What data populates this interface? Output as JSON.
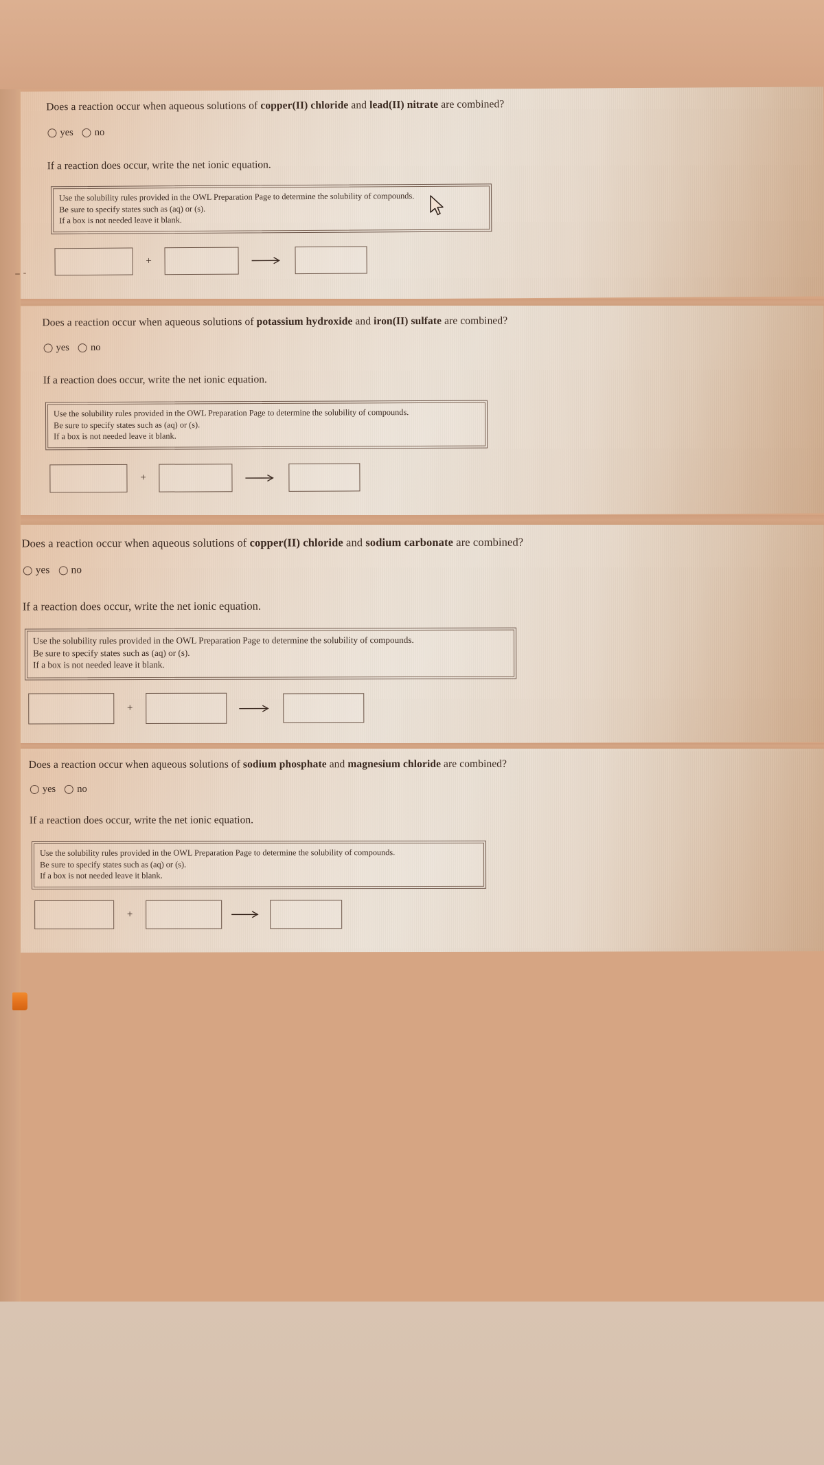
{
  "page": {
    "background_color": "#d6a583",
    "panel_color": "#e9ded1",
    "text_color": "#3a2920",
    "accent_color": "#e2701c"
  },
  "common": {
    "question_prefix": "Does a reaction occur when aqueous solutions of ",
    "question_conjunction": " and ",
    "question_suffix": " are combined?",
    "radio_yes_label": "yes",
    "radio_no_label": "no",
    "net_ionic_prompt": "If a reaction does occur, write the net ionic equation.",
    "note_line_1": "Use the solubility rules provided in the OWL Preparation Page to determine the solubility of compounds.",
    "note_line_2": "Be sure to specify states such as (aq) or (s).",
    "note_line_3": "If a box is not needed leave it blank.",
    "plus_symbol": "+",
    "arrow_symbol": "⟶",
    "input_value": "",
    "input_placeholder": ""
  },
  "questions": [
    {
      "id": "q1",
      "reactant_a": "copper(II) chloride",
      "reactant_b": "lead(II) nitrate",
      "selected": "",
      "box_left_value": "",
      "box_middle_value": "",
      "box_right_value": ""
    },
    {
      "id": "q2",
      "reactant_a": "potassium hydroxide",
      "reactant_b": "iron(II) sulfate",
      "selected": "",
      "box_left_value": "",
      "box_middle_value": "",
      "box_right_value": ""
    },
    {
      "id": "q3",
      "reactant_a": "copper(II) chloride",
      "reactant_b": "sodium carbonate",
      "selected": "",
      "box_left_value": "",
      "box_middle_value": "",
      "box_right_value": ""
    },
    {
      "id": "q4",
      "reactant_a": "sodium phosphate",
      "reactant_b": "magnesium chloride",
      "selected": "",
      "box_left_value": "",
      "box_middle_value": "",
      "box_right_value": ""
    }
  ]
}
